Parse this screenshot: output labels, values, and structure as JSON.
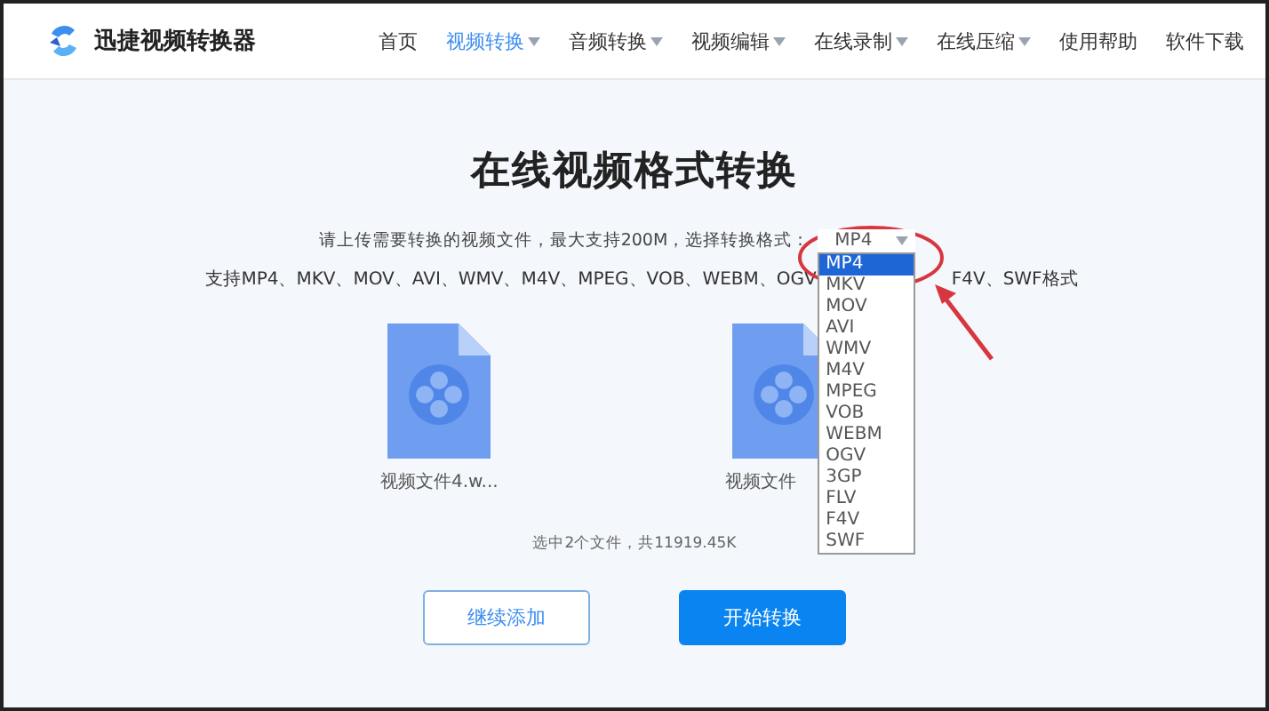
{
  "header": {
    "brand": "迅捷视频转换器",
    "nav": [
      {
        "label": "首页",
        "selected": false,
        "dropdown": false
      },
      {
        "label": "视频转换",
        "selected": true,
        "dropdown": true
      },
      {
        "label": "音频转换",
        "selected": false,
        "dropdown": true
      },
      {
        "label": "视频编辑",
        "selected": false,
        "dropdown": true
      },
      {
        "label": "在线录制",
        "selected": false,
        "dropdown": true
      },
      {
        "label": "在线压缩",
        "selected": false,
        "dropdown": true
      },
      {
        "label": "使用帮助",
        "selected": false,
        "dropdown": false
      },
      {
        "label": "软件下载",
        "selected": false,
        "dropdown": false
      }
    ]
  },
  "title": "在线视频格式转换",
  "upload_hint": "请上传需要转换的视频文件，最大支持200M，选择转换格式：",
  "format_select": {
    "value": "MP4",
    "options": [
      {
        "label": "MP4",
        "selected": true
      },
      {
        "label": "MKV",
        "selected": false
      },
      {
        "label": "MOV",
        "selected": false
      },
      {
        "label": "AVI",
        "selected": false
      },
      {
        "label": "WMV",
        "selected": false
      },
      {
        "label": "M4V",
        "selected": false
      },
      {
        "label": "MPEG",
        "selected": false
      },
      {
        "label": "VOB",
        "selected": false
      },
      {
        "label": "WEBM",
        "selected": false
      },
      {
        "label": "OGV",
        "selected": false
      },
      {
        "label": "3GP",
        "selected": false
      },
      {
        "label": "FLV",
        "selected": false
      },
      {
        "label": "F4V",
        "selected": false
      },
      {
        "label": "SWF",
        "selected": false
      }
    ]
  },
  "supported_formats": [
    "支持MP4、MKV、MOV、AVI、WMV、M4V、MPEG、VOB、WEBM、OGV",
    "F4V、SWF格式"
  ],
  "files": [
    {
      "name": "视频文件4.w..."
    },
    {
      "name": "视频文件"
    }
  ],
  "summary": "选中2个文件，共11919.45K",
  "buttons": [
    {
      "label": "继续添加",
      "kind": "secondary"
    },
    {
      "label": "开始转换",
      "kind": "primary"
    }
  ]
}
